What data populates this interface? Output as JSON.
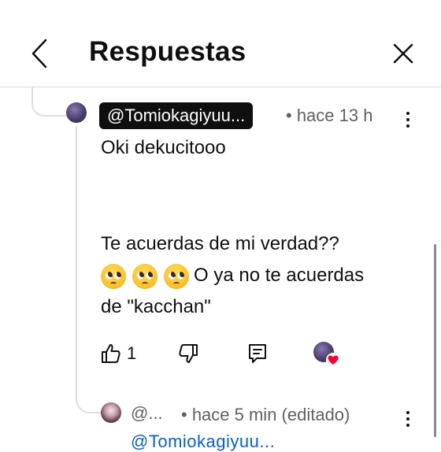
{
  "header": {
    "title": "Respuestas"
  },
  "comment": {
    "username": "@Tomiokagiyuu...",
    "time": "• hace 13 h",
    "lines": [
      "Oki dekucitooo",
      "Te acuerdas de mi verdad??",
      "O ya no te acuerdas",
      "de \"kacchan\""
    ],
    "like_count": "1"
  },
  "reply": {
    "username": "@...",
    "time": "• hace 5 min (editado)",
    "preview_text": "@Tomiokagiyuu..."
  },
  "icons": {
    "back": "chevron-left-icon",
    "close": "close-icon",
    "more": "more-vertical-icon",
    "like": "thumbs-up-icon",
    "dislike": "thumbs-down-icon",
    "reply": "reply-icon",
    "heart": "heart-icon",
    "emoji": "pleading-face-emoji"
  },
  "colors": {
    "accent_link": "#065fd4",
    "heart": "#ff0033",
    "badge_bg": "#0f0f0f"
  }
}
